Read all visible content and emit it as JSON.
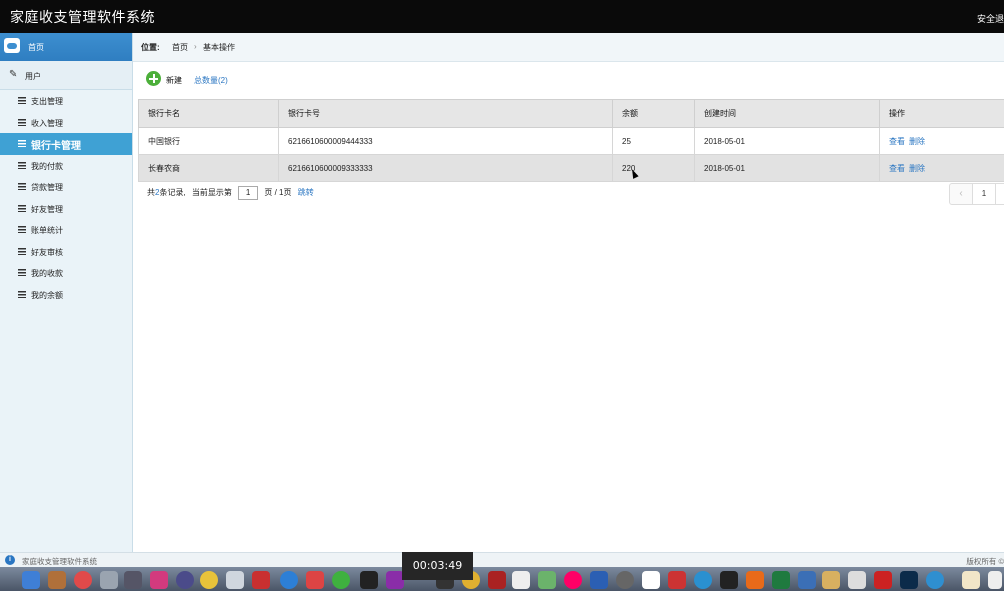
{
  "app": {
    "title": "家庭收支管理软件系统",
    "top_right": "安全退"
  },
  "sidebar": {
    "home_label": "首页",
    "user_label": "用户",
    "items": [
      {
        "label": "支出管理",
        "active": false
      },
      {
        "label": "收入管理",
        "active": false
      },
      {
        "label": "银行卡管理",
        "active": true
      },
      {
        "label": "我的付款",
        "active": false
      },
      {
        "label": "贷款管理",
        "active": false
      },
      {
        "label": "好友管理",
        "active": false
      },
      {
        "label": "账单统计",
        "active": false
      },
      {
        "label": "好友审核",
        "active": false
      },
      {
        "label": "我的收款",
        "active": false
      },
      {
        "label": "我的余额",
        "active": false
      }
    ]
  },
  "breadcrumb": {
    "prefix": "位置:",
    "home": "首页",
    "sep": "›",
    "current": "基本操作"
  },
  "toolbar": {
    "add_label": "新建",
    "count_label": "总数量(2)"
  },
  "table": {
    "headers": [
      "银行卡名",
      "银行卡号",
      "余额",
      "创建时间",
      "操作"
    ],
    "rows": [
      {
        "name": "中国银行",
        "number": "6216610600009444333",
        "balance": "25",
        "created": "2018-05-01",
        "view": "查看",
        "delete": "删除"
      },
      {
        "name": "长春农商",
        "number": "6216610600009333333",
        "balance": "220",
        "created": "2018-05-01",
        "view": "查看",
        "delete": "删除"
      }
    ]
  },
  "pager": {
    "total_prefix": "共",
    "total": "2",
    "total_suffix": "条记录,",
    "current_prefix": "当前显示第",
    "page_value": "1",
    "page_suffix": "页 / 1页",
    "jump": "跳转",
    "prev": "‹",
    "page_num": "1"
  },
  "footer": {
    "left": "家庭收支管理软件系统",
    "right": "版权所有 ©"
  },
  "timer": "00:03:49"
}
